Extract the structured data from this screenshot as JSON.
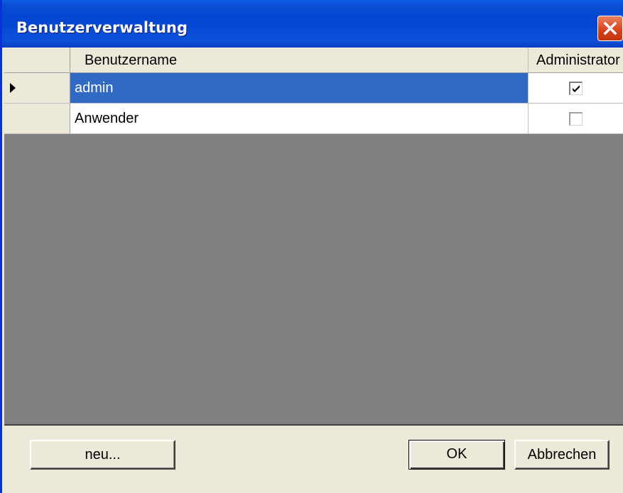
{
  "window": {
    "title": "Benutzerverwaltung"
  },
  "grid": {
    "columns": [
      "Benutzername",
      "Administrator"
    ],
    "rows": [
      {
        "name": "admin",
        "administrator": true,
        "selected": true
      },
      {
        "name": "Anwender",
        "administrator": false,
        "selected": false
      }
    ]
  },
  "buttons": {
    "new_label": "neu...",
    "ok_label": "OK",
    "cancel_label": "Abbrechen"
  },
  "colors": {
    "titlebar": "#0246d1",
    "selection": "#316ac5",
    "grid_background": "#808080"
  }
}
